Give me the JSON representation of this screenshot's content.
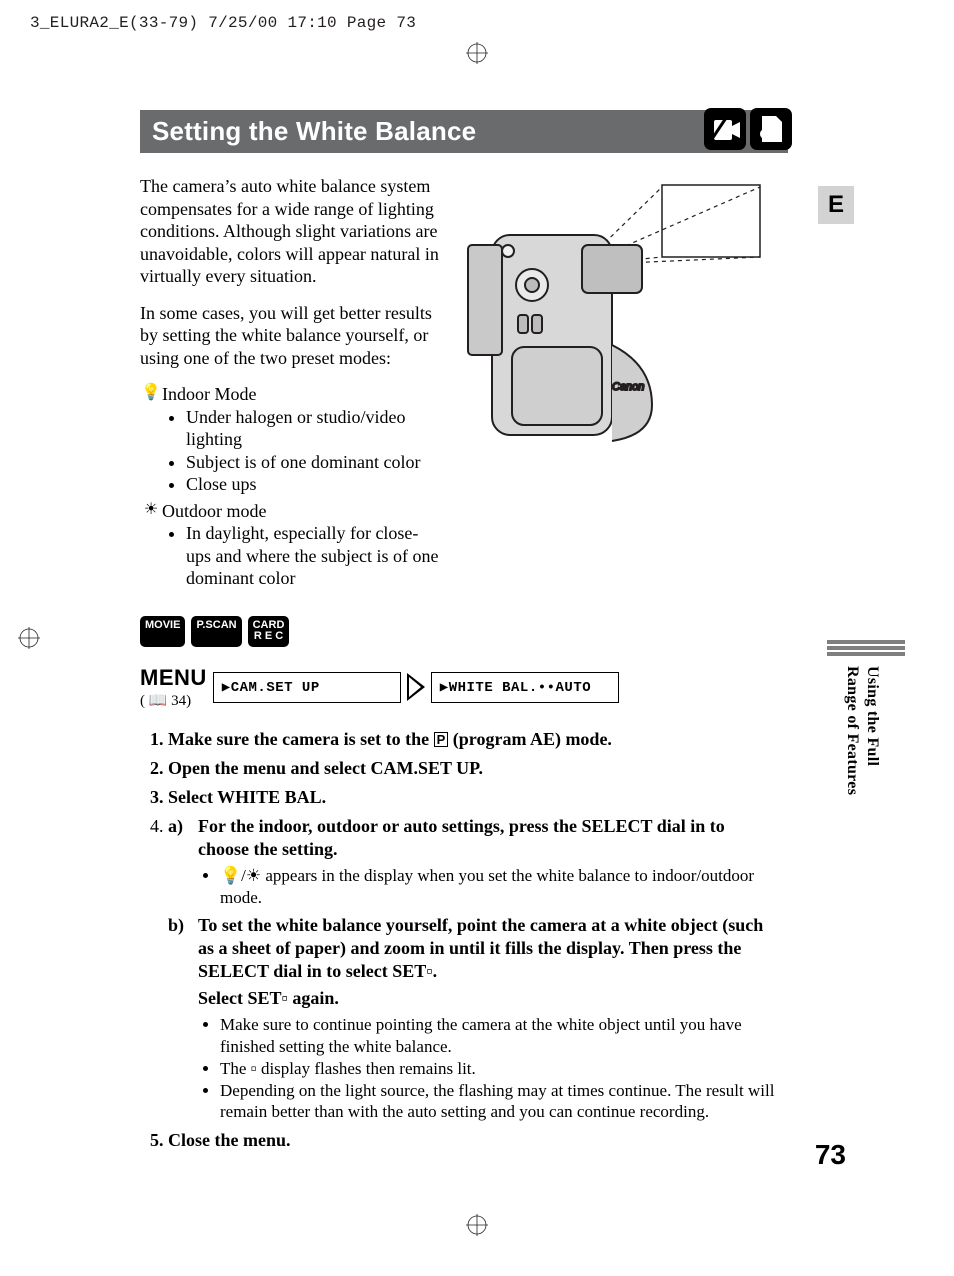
{
  "meta": {
    "slug": "3_ELURA2_E(33-79)  7/25/00 17:10  Page 73"
  },
  "sidebar": {
    "lang": "E",
    "section_line1": "Using the Full",
    "section_line2": "Range of Features"
  },
  "title": "Setting the White Balance",
  "intro": {
    "p1": "The camera’s auto white balance system compensates for a wide range of lighting conditions. Although slight variations are unavoidable, colors will appear natural in virtually every situation.",
    "p2": "In some cases, you will get better results by setting the white balance yourself, or using one of the two preset modes:",
    "indoor_label": "Indoor Mode",
    "indoor_bullets": [
      "Under halogen or studio/video lighting",
      "Subject is of one dominant color",
      "Close ups"
    ],
    "outdoor_label": "Outdoor mode",
    "outdoor_bullets": [
      "In daylight, especially for close-ups and where the subject is of one dominant color"
    ]
  },
  "badges": {
    "b1": "MOVIE",
    "b2": "P.SCAN",
    "b3a": "CARD",
    "b3b": "R E C"
  },
  "menu": {
    "word": "MENU",
    "ref": "( 📖 34)",
    "box1": "▶CAM.SET UP",
    "box2": "▶WHITE BAL.••AUTO"
  },
  "steps": {
    "s1a": "Make sure the camera is set to the ",
    "s1b": " (program AE) mode.",
    "s1_pbox": "P",
    "s2": "Open the menu and select CAM.SET UP.",
    "s3": "Select WHITE BAL.",
    "s4a_letter": "a)",
    "s4a": "For the indoor, outdoor or auto settings, press the SELECT dial in to choose the setting.",
    "s4a_sub": "💡/☀ appears in the display when you set the white balance to indoor/outdoor mode.",
    "s4b_letter": "b)",
    "s4b_1": "To set the white balance yourself, point the camera at a white object (such as a sheet of paper) and zoom in until it fills the display. Then press the SELECT dial in to select SET▫.",
    "s4b_2": "Select SET▫ again.",
    "s4b_bullets": [
      "Make sure to continue pointing the camera at the white object until you have finished setting the white balance.",
      "The ▫ display flashes then remains lit.",
      "Depending on the light source, the flashing may at times continue. The result will remain better than with the auto setting and you can continue recording."
    ],
    "s5": "Close the menu."
  },
  "page_number": "73"
}
